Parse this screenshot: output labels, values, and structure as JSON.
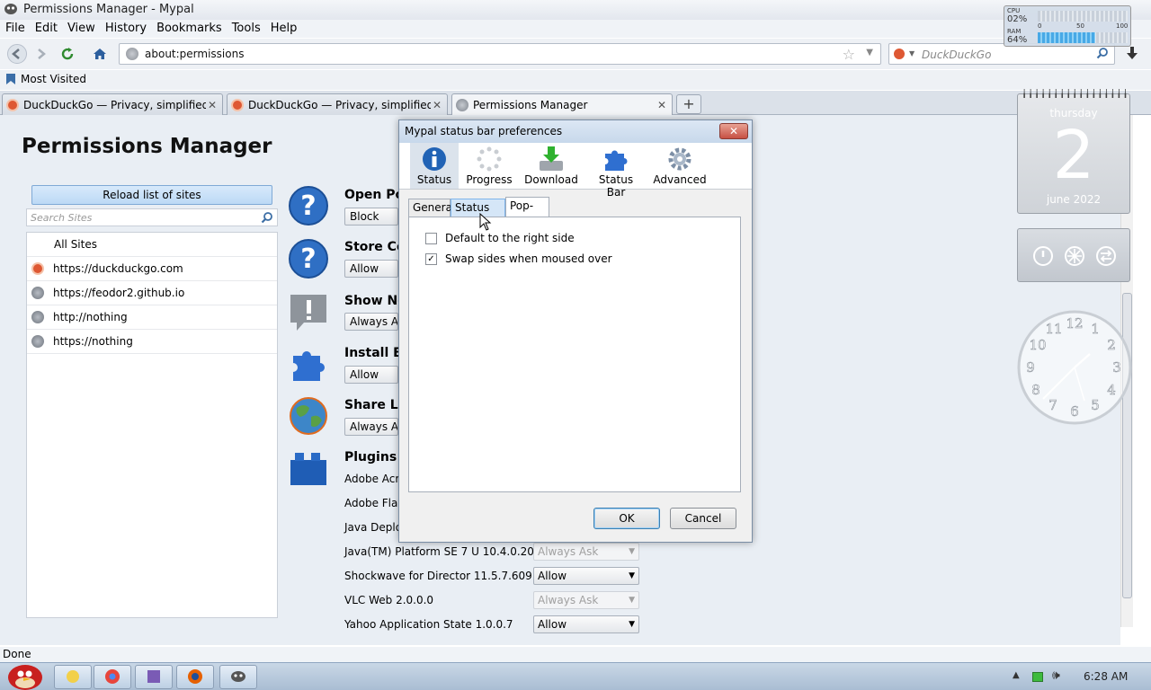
{
  "window": {
    "title": "Permissions Manager - Mypal"
  },
  "menu": [
    "File",
    "Edit",
    "View",
    "History",
    "Bookmarks",
    "Tools",
    "Help"
  ],
  "nav": {
    "url": "about:permissions",
    "search_placeholder": "DuckDuckGo"
  },
  "bookmarks": {
    "most_visited": "Most Visited"
  },
  "tabs": [
    {
      "label": "DuckDuckGo — Privacy, simplified.",
      "icon": "duckduckgo-icon"
    },
    {
      "label": "DuckDuckGo — Privacy, simplified.",
      "icon": "duckduckgo-icon"
    },
    {
      "label": "Permissions Manager",
      "icon": "globe-icon"
    }
  ],
  "page": {
    "title": "Permissions Manager",
    "reload_label": "Reload list of sites",
    "search_placeholder": "Search Sites",
    "sites": [
      "All Sites",
      "https://duckduckgo.com",
      "https://feodor2.github.io",
      "http://nothing",
      "https://nothing"
    ],
    "permissions": [
      {
        "title": "Open Po",
        "value": "Block"
      },
      {
        "title": "Store Co",
        "value": "Allow"
      },
      {
        "title": "Show No",
        "value": "Always As"
      },
      {
        "title": "Install Ex",
        "value": "Allow"
      },
      {
        "title": "Share Lo",
        "value": "Always As"
      }
    ],
    "plugins_title": "Plugins",
    "plugins": [
      {
        "name": "Adobe Acro",
        "value": ""
      },
      {
        "name": "Adobe Flas",
        "value": ""
      },
      {
        "name": "Java Deploy",
        "value": ""
      },
      {
        "name": "Java(TM) Platform SE 7 U 10.4.0.20",
        "value": "Always Ask"
      },
      {
        "name": "Shockwave for Director 11.5.7.609",
        "value": "Allow"
      },
      {
        "name": "VLC Web 2.0.0.0",
        "value": "Always Ask"
      },
      {
        "name": "Yahoo Application State 1.0.0.7",
        "value": "Allow"
      }
    ]
  },
  "status_text": "Done",
  "dialog": {
    "title": "Mypal status bar preferences",
    "panes": [
      "Status",
      "Progress",
      "Download",
      "Status Bar",
      "Advanced"
    ],
    "active_pane": "Status",
    "subtabs": [
      "General",
      "Status Bar",
      "Pop-up"
    ],
    "active_subtab": "Pop-up",
    "options": [
      {
        "label": "Default to the right side",
        "checked": false
      },
      {
        "label": "Swap sides when moused over",
        "checked": true
      }
    ],
    "ok_label": "OK",
    "cancel_label": "Cancel"
  },
  "gadgets": {
    "sysmon": {
      "cpu_label": "CPU",
      "cpu_value": "02%",
      "ram_label": "RAM",
      "ram_value": "64%",
      "scale": [
        "0",
        "50",
        "100"
      ]
    },
    "calendar": {
      "day": "thursday",
      "date": "2",
      "month": "june 2022"
    }
  },
  "taskbar": {
    "time": "6:28 AM"
  }
}
